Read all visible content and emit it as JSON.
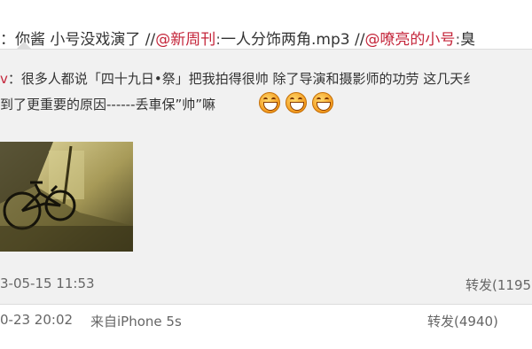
{
  "row1": {
    "prefix": "：你酱 小号没戏演了 //",
    "mention1": "@新周刊",
    "colon1": ":",
    "text1": "一人分饰两角.mp3 //",
    "mention2": "@嘹亮的小号",
    "colon2": ":",
    "tail": "臭"
  },
  "repost": {
    "author_tail": "v",
    "text_line1": "：很多人都说「四十九日•祭」把我拍得很帅 除了导演和摄影师的功劳 这几天纟",
    "text_line2": "到了更重要的原因------丢車保”帅”嘛",
    "emoji_count": 3,
    "emoji_name": "haha-laugh-icon",
    "timestamp": "3-05-15 11:53",
    "repost_label": "转发(1195"
  },
  "footer": {
    "timestamp": "0-23 20:02",
    "source": "来自iPhone 5s",
    "repost_label": "转发(4940)"
  },
  "colors": {
    "link": "#c4253a",
    "panel_bg": "#f1f1f1"
  }
}
